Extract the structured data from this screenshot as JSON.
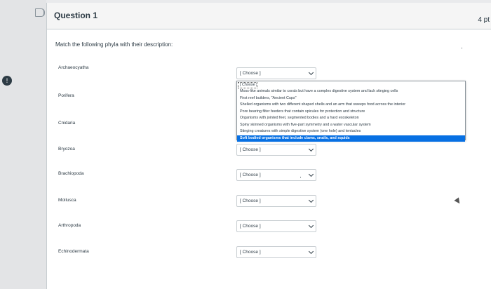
{
  "question": {
    "title": "Question 1",
    "points": "4 pt",
    "prompt": "Match the following phyla with their description:"
  },
  "status_icon": "info-circle-icon",
  "rows": [
    {
      "term": "Archaeocyatha",
      "selected": "[ Choose ]"
    },
    {
      "term": "Porifera",
      "selected": "[ Choose ]"
    },
    {
      "term": "Cnidaria",
      "selected": "[ Choose ]"
    },
    {
      "term": "Bryozoa",
      "selected": "[ Choose ]"
    },
    {
      "term": "Brachiopoda",
      "selected": "[ Choose ]"
    },
    {
      "term": "Mollusca",
      "selected": "[ Choose ]"
    },
    {
      "term": "Arthropoda",
      "selected": "[ Choose ]"
    },
    {
      "term": "Echinodermata",
      "selected": "[ Choose ]"
    }
  ],
  "dropdown": {
    "options": [
      "[ Choose ]",
      "Moss-like animals similar to corals but have a complex digestive system and lack stinging cells",
      "First reef builders, \"Ancient Cups\"",
      "Shelled organisms with two different shaped shells and an arm that sweeps food across the interior",
      "Pore bearing filter feeders that contain spicules for protection and structure",
      "Organisms with jointed feet, segmented bodies and a hard exoskeleton",
      "Spiny skinned organisms with five-part symmetry and a water vascular system",
      "Stinging creatures with simple digestive system (one hole) and tentacles",
      "Soft bodied organisms that include clams, snails, and squids"
    ],
    "highlighted": "Soft bodied organisms that include clams, snails, and squids"
  },
  "colors": {
    "accent": "#0770e3",
    "text": "#2d3b45",
    "border": "#c7cdd1"
  }
}
